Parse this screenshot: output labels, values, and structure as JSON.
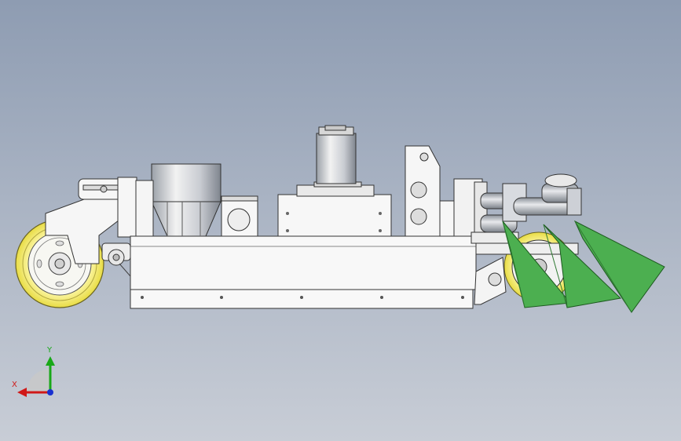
{
  "triad": {
    "x_label": "X",
    "y_label": "Y",
    "x_color": "#d01818",
    "y_color": "#18a818",
    "z_color": "#1830d0"
  },
  "colors": {
    "background_top": "#8e9cb2",
    "background_bottom": "#c8cdd6",
    "part_fill": "#f4f4f4",
    "part_stroke": "#3a3a3a",
    "wheel_yellow": "#f2ea6a",
    "blade_green": "#4caf50",
    "metal_gray": "#b8bcc4"
  }
}
